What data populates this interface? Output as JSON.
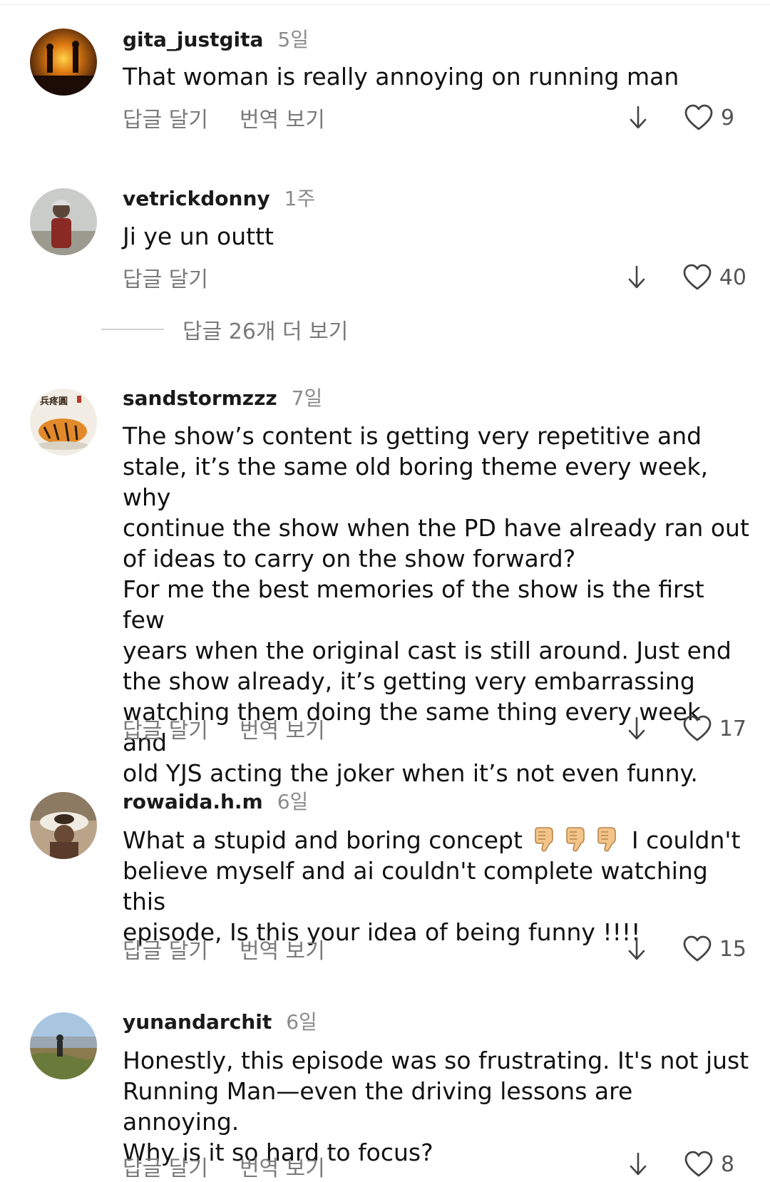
{
  "comments": [
    {
      "user": "gita_justgita",
      "time": "5일",
      "text": [
        "That woman is really annoying on running man"
      ],
      "reply": "답글 달기",
      "translate": "번역 보기",
      "likes": "9"
    },
    {
      "user": "vetrickdonny",
      "time": "1주",
      "text": [
        "Ji ye un outtt"
      ],
      "reply": "답글 달기",
      "likes": "40",
      "more_replies": "답글 26개 더 보기"
    },
    {
      "user": "sandstormzzz",
      "time": "7일",
      "text": [
        "The show’s content is getting very repetitive and",
        "stale, it’s the same old boring theme every week, why",
        "continue the show when the PD have already ran out",
        "of ideas to carry on the show forward?",
        "For me the best memories of the show is the first few",
        "years when the original cast is still around. Just end",
        "the show already, it’s getting very embarrassing",
        "watching them doing the same thing every week and",
        "old YJS acting the joker when it’s not even funny."
      ],
      "reply": "답글 달기",
      "translate": "번역 보기",
      "likes": "17"
    },
    {
      "user": "rowaida.h.m",
      "time": "6일",
      "text_a": "What a stupid and boring concept",
      "text_b": "I couldn't",
      "text_rest": [
        "believe myself and ai couldn't complete watching this",
        "episode, Is this your idea of being funny !!!!"
      ],
      "reply": "답글 달기",
      "translate": "번역 보기",
      "likes": "15"
    },
    {
      "user": "yunandarchit",
      "time": "6일",
      "text": [
        "Honestly, this episode was so frustrating. It's not just",
        "Running Man—even the driving lessons are annoying.",
        "Why is it so hard to focus?"
      ],
      "reply": "답글 달기",
      "translate": "번역 보기",
      "likes": "8"
    }
  ],
  "icons": {
    "like": "heart-outline-icon",
    "sort": "down-arrow-icon",
    "emoji": "thumbs-down-emoji"
  },
  "colors": {
    "secondary_text": "#7a7a7a",
    "background": "#ffffff"
  }
}
